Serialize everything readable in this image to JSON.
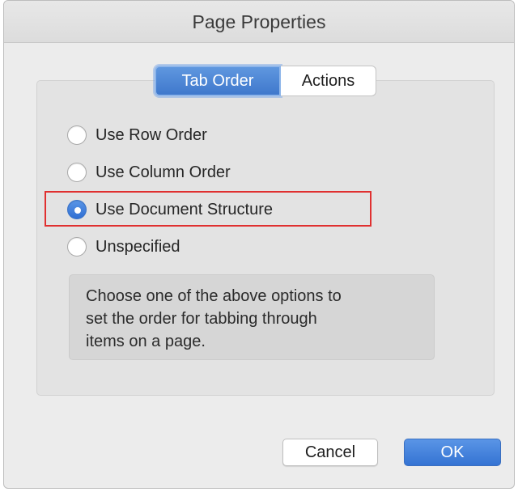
{
  "window": {
    "title": "Page Properties"
  },
  "tabs": [
    {
      "label": "Tab Order",
      "selected": true
    },
    {
      "label": "Actions",
      "selected": false
    }
  ],
  "tab_order": {
    "options": [
      {
        "label": "Use Row Order",
        "checked": false
      },
      {
        "label": "Use Column Order",
        "checked": false
      },
      {
        "label": "Use Document Structure",
        "checked": true,
        "highlighted": true
      },
      {
        "label": "Unspecified",
        "checked": false
      }
    ],
    "description_lines": [
      "Choose one of the above options to",
      "set the order for tabbing through",
      "items on a page."
    ]
  },
  "buttons": {
    "cancel_label": "Cancel",
    "ok_label": "OK"
  },
  "colors": {
    "accent": "#3f78cc",
    "highlight_border": "#e03030",
    "dialog_background": "#ececec"
  }
}
